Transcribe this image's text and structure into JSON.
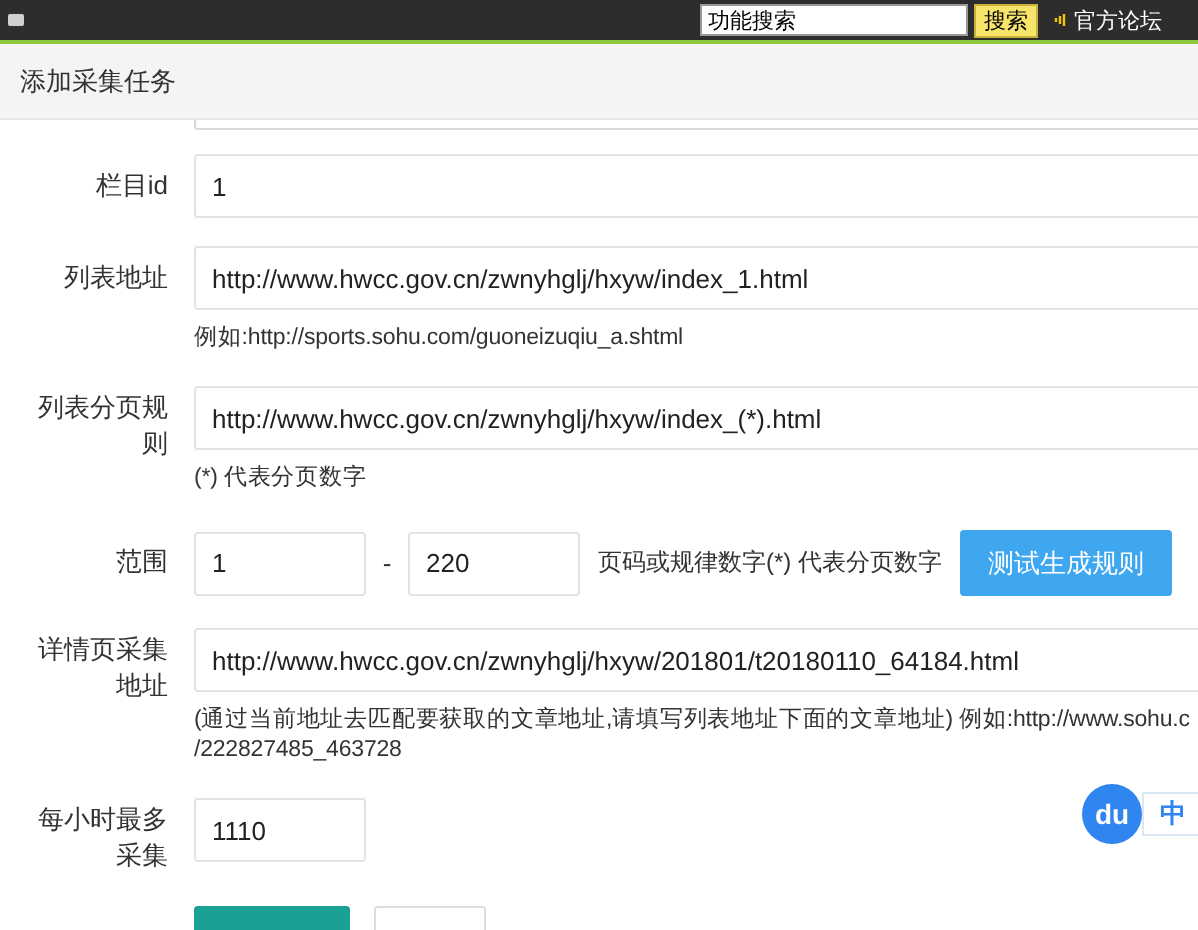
{
  "top_bar": {
    "search": {
      "value": "功能搜索"
    },
    "search_button": "搜索",
    "forum_link": "官方论坛"
  },
  "header": {
    "title": "添加采集任务"
  },
  "form": {
    "rows": [
      {
        "kind": "text",
        "label": "栏目id",
        "value": "1"
      },
      {
        "kind": "text",
        "label": "列表地址",
        "value": "http://www.hwcc.gov.cn/zwnyhglj/hxyw/index_1.html",
        "help": [
          "例如:http://sports.sohu.com/guoneizuqiu_a.shtml"
        ]
      },
      {
        "kind": "text",
        "label": "列表分页规则",
        "value": "http://www.hwcc.gov.cn/zwnyhglj/hxyw/index_(*).html",
        "help": [
          "(*) 代表分页数字"
        ]
      },
      {
        "kind": "range",
        "label": "范围",
        "from": "1",
        "separator": "-",
        "to": "220",
        "note": "页码或规律数字(*) 代表分页数字",
        "button": "测试生成规则"
      },
      {
        "kind": "text",
        "label": "详情页采集地址",
        "value": "http://www.hwcc.gov.cn/zwnyhglj/hxyw/201801/t20180110_64184.html",
        "help": [
          "(通过当前地址去匹配要获取的文章地址,请填写列表地址下面的文章地址) 例如:http://www.sohu.c",
          "/222827485_463728"
        ]
      },
      {
        "kind": "short",
        "label": "每小时最多采集",
        "value": "1110"
      }
    ]
  },
  "ime_badge": {
    "logo": "du",
    "mode": "中"
  }
}
